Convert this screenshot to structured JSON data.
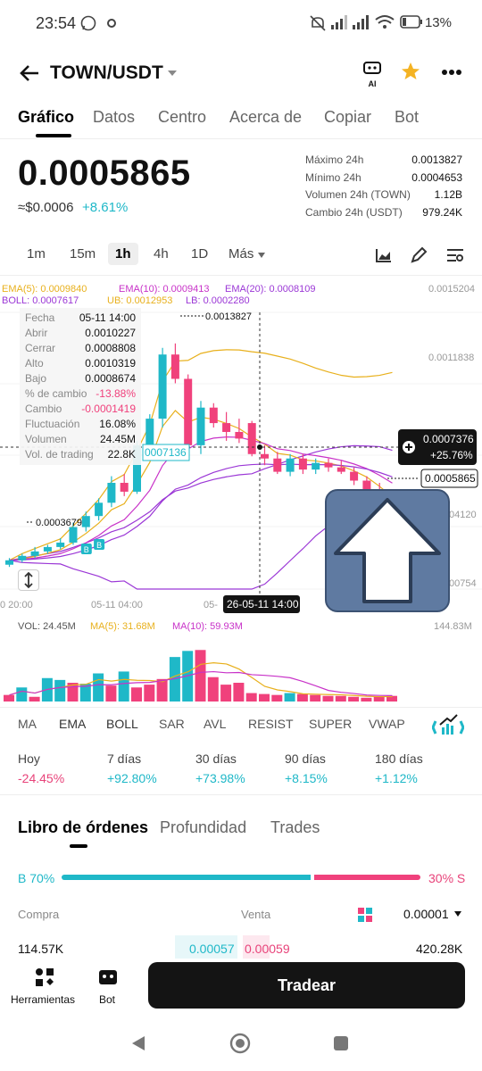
{
  "status": {
    "time": "23:54",
    "battery": "13%"
  },
  "header": {
    "pair": "TOWN/USDT",
    "ai_label": "AI"
  },
  "tabs": [
    "Gráfico",
    "Datos",
    "Centro",
    "Acerca de",
    "Copiar",
    "Bot"
  ],
  "ticker": {
    "price": "0.0005865",
    "fiat": "≈$0.0006",
    "change": "+8.61%",
    "stats": [
      {
        "label": "Máximo 24h",
        "value": "0.0013827"
      },
      {
        "label": "Mínimo 24h",
        "value": "0.0004653"
      },
      {
        "label": "Volumen 24h (TOWN)",
        "value": "1.12B"
      },
      {
        "label": "Cambio 24h (USDT)",
        "value": "979.24K"
      }
    ]
  },
  "intervals": [
    "1m",
    "15m",
    "1h",
    "4h",
    "1D",
    "Más"
  ],
  "chart_data": {
    "type": "candlestick",
    "ema_legend": [
      "EMA(5): 0.0009840",
      "EMA(10): 0.0009413",
      "EMA(20): 0.0008109"
    ],
    "boll_legend": [
      "BOLL: 0.0007617",
      "UB: 0.0012953",
      "LB: 0.0002280"
    ],
    "y_axis_labels": [
      "0.0015204",
      "0.0011838",
      "04120",
      "00754"
    ],
    "x_axis_labels": [
      "0 20:00",
      "05-11 04:00",
      "05-",
      "26-05-11 14:00"
    ],
    "high_marker": "0.0013827",
    "low_marker": "0.0003679",
    "current_price_tag": "0.0005865",
    "cursor_price": "0.0007376",
    "cursor_change": "+25.76%",
    "left_tag": "0007136",
    "tooltip": [
      {
        "k": "Fecha",
        "v": "05-11 14:00"
      },
      {
        "k": "Abrir",
        "v": "0.0010227"
      },
      {
        "k": "Cerrar",
        "v": "0.0008808"
      },
      {
        "k": "Alto",
        "v": "0.0010319"
      },
      {
        "k": "Bajo",
        "v": "0.0008674"
      },
      {
        "k": "% de cambio",
        "v": "-13.88%"
      },
      {
        "k": "Cambio",
        "v": "-0.0001419"
      },
      {
        "k": "Fluctuación",
        "v": "16.08%"
      },
      {
        "k": "Volumen",
        "v": "24.45M"
      },
      {
        "k": "Vol. de trading",
        "v": "22.8K"
      }
    ],
    "candles": [
      {
        "o": 0.00038,
        "h": 0.00041,
        "l": 0.00037,
        "c": 0.0004
      },
      {
        "o": 0.0004,
        "h": 0.00043,
        "l": 0.00039,
        "c": 0.00042
      },
      {
        "o": 0.00042,
        "h": 0.00046,
        "l": 0.00041,
        "c": 0.00044
      },
      {
        "o": 0.00044,
        "h": 0.00047,
        "l": 0.00043,
        "c": 0.00046
      },
      {
        "o": 0.00046,
        "h": 0.0005,
        "l": 0.00045,
        "c": 0.00048
      },
      {
        "o": 0.00048,
        "h": 0.00057,
        "l": 0.00047,
        "c": 0.00055
      },
      {
        "o": 0.00055,
        "h": 0.00062,
        "l": 0.00053,
        "c": 0.0006
      },
      {
        "o": 0.0006,
        "h": 0.00068,
        "l": 0.00058,
        "c": 0.00066
      },
      {
        "o": 0.00066,
        "h": 0.00078,
        "l": 0.00064,
        "c": 0.00075
      },
      {
        "o": 0.00075,
        "h": 0.00079,
        "l": 0.00069,
        "c": 0.00071
      },
      {
        "o": 0.00071,
        "h": 0.00094,
        "l": 0.0007,
        "c": 0.00092
      },
      {
        "o": 0.00092,
        "h": 0.00106,
        "l": 0.00088,
        "c": 0.00104
      },
      {
        "o": 0.00104,
        "h": 0.00136,
        "l": 0.001,
        "c": 0.00133
      },
      {
        "o": 0.00133,
        "h": 0.00138,
        "l": 0.0012,
        "c": 0.00122
      },
      {
        "o": 0.00122,
        "h": 0.00124,
        "l": 0.0009,
        "c": 0.00092
      },
      {
        "o": 0.00092,
        "h": 0.00112,
        "l": 0.00088,
        "c": 0.00109
      },
      {
        "o": 0.00109,
        "h": 0.00111,
        "l": 0.001,
        "c": 0.00102
      },
      {
        "o": 0.00102,
        "h": 0.00107,
        "l": 0.00094,
        "c": 0.00098
      },
      {
        "o": 0.00098,
        "h": 0.00104,
        "l": 0.00093,
        "c": 0.00095
      },
      {
        "o": 0.00102,
        "h": 0.00103,
        "l": 0.00087,
        "c": 0.00088
      },
      {
        "o": 0.00088,
        "h": 0.00092,
        "l": 0.00083,
        "c": 0.00086
      },
      {
        "o": 0.00086,
        "h": 0.00089,
        "l": 0.00079,
        "c": 0.0008
      },
      {
        "o": 0.0008,
        "h": 0.00088,
        "l": 0.00078,
        "c": 0.00086
      },
      {
        "o": 0.00086,
        "h": 0.00088,
        "l": 0.00079,
        "c": 0.00081
      },
      {
        "o": 0.00081,
        "h": 0.00086,
        "l": 0.00079,
        "c": 0.00084
      },
      {
        "o": 0.00084,
        "h": 0.00086,
        "l": 0.0008,
        "c": 0.00082
      },
      {
        "o": 0.00082,
        "h": 0.00085,
        "l": 0.00079,
        "c": 0.0008
      },
      {
        "o": 0.0008,
        "h": 0.00082,
        "l": 0.00074,
        "c": 0.00076
      },
      {
        "o": 0.00076,
        "h": 0.00078,
        "l": 0.00071,
        "c": 0.00072
      },
      {
        "o": 0.00072,
        "h": 0.00075,
        "l": 0.00062,
        "c": 0.00065
      },
      {
        "o": 0.00065,
        "h": 0.00067,
        "l": 0.00057,
        "c": 0.00059
      }
    ],
    "volume_legend": [
      "VOL: 24.45M",
      "MA(5): 31.68M",
      "MA(10): 59.93M"
    ],
    "volume_max_label": "144.83M",
    "volumes": [
      {
        "v": 14,
        "up": false
      },
      {
        "v": 30,
        "up": true
      },
      {
        "v": 10,
        "up": false
      },
      {
        "v": 50,
        "up": true
      },
      {
        "v": 46,
        "up": true
      },
      {
        "v": 40,
        "up": false
      },
      {
        "v": 38,
        "up": true
      },
      {
        "v": 60,
        "up": true
      },
      {
        "v": 34,
        "up": false
      },
      {
        "v": 64,
        "up": true
      },
      {
        "v": 30,
        "up": false
      },
      {
        "v": 36,
        "up": false
      },
      {
        "v": 48,
        "up": false
      },
      {
        "v": 95,
        "up": true
      },
      {
        "v": 108,
        "up": true
      },
      {
        "v": 110,
        "up": false
      },
      {
        "v": 52,
        "up": false
      },
      {
        "v": 36,
        "up": false
      },
      {
        "v": 40,
        "up": false
      },
      {
        "v": 18,
        "up": false
      },
      {
        "v": 16,
        "up": false
      },
      {
        "v": 14,
        "up": false
      },
      {
        "v": 18,
        "up": true
      },
      {
        "v": 16,
        "up": false
      },
      {
        "v": 14,
        "up": false
      },
      {
        "v": 12,
        "up": false
      },
      {
        "v": 12,
        "up": false
      },
      {
        "v": 10,
        "up": false
      },
      {
        "v": 8,
        "up": false
      },
      {
        "v": 10,
        "up": false
      },
      {
        "v": 12,
        "up": false
      }
    ]
  },
  "indicators": [
    "MA",
    "EMA",
    "BOLL",
    "SAR",
    "AVL",
    "RESIST",
    "SUPER",
    "VWAP"
  ],
  "performance": [
    {
      "label": "Hoy",
      "value": "-24.45%"
    },
    {
      "label": "7 días",
      "value": "+92.80%"
    },
    {
      "label": "30 días",
      "value": "+73.98%"
    },
    {
      "label": "90 días",
      "value": "+8.15%"
    },
    {
      "label": "180 días",
      "value": "+1.12%"
    }
  ],
  "orderbook": {
    "tabs": [
      "Libro de órdenes",
      "Profundidad",
      "Trades"
    ],
    "buy_pct": "B 70%",
    "sell_pct": "30% S",
    "buy_ratio": 0.7,
    "col_buy": "Compra",
    "col_sell": "Venta",
    "precision": "0.00001",
    "row": {
      "buy_qty": "114.57K",
      "buy_price": "0.00057",
      "sell_price": "0.00059",
      "sell_qty": "420.28K"
    }
  },
  "bottom": {
    "tools": "Herramientas",
    "bot": "Bot",
    "trade": "Tradear"
  },
  "colors": {
    "up": "#1fb8c8",
    "down": "#f0417c",
    "ema5": "#e8b01c",
    "ema10": "#c832c8",
    "ema20": "#9b37d6"
  }
}
